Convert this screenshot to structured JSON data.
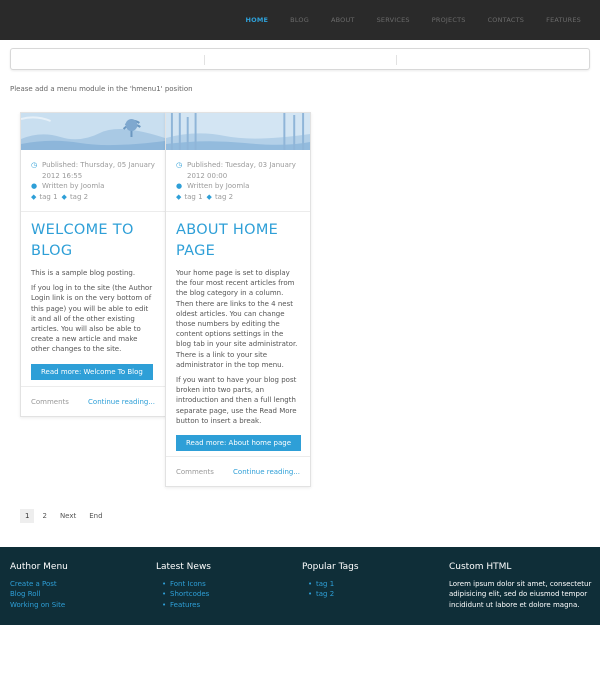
{
  "nav": {
    "items": [
      "HOME",
      "BLOG",
      "ABOUT",
      "SERVICES",
      "PROJECTS",
      "CONTACTS",
      "FEATURES"
    ]
  },
  "notice": "Please add a menu module in the 'hmenu1' position",
  "articles": [
    {
      "published": "Published: Thursday, 05 January 2012 16:55",
      "author": "Written by Joomla",
      "tag1": "tag 1",
      "tag2": "tag 2",
      "title": "WELCOME TO BLOG",
      "p1": "This is a sample blog posting.",
      "p2": "If you log in to the site (the Author Login link is on the very bottom of this page) you will be able to edit it and all of the other existing articles. You will also be able to create a new article and make other changes to the site.",
      "readmore": "Read more: Welcome To Blog",
      "comments": "Comments",
      "continue": "Continue reading..."
    },
    {
      "published": "Published: Tuesday, 03 January 2012 00:00",
      "author": "Written by Joomla",
      "tag1": "tag 1",
      "tag2": "tag 2",
      "title": "ABOUT HOME PAGE",
      "p1": "Your home page is set to display the four most recent articles from the blog category in a column. Then there are links to the 4 nest oldest articles. You can change those numbers by editing the content options settings in the blog tab in your site administrator. There is a link to your site administrator in the top menu.",
      "p2": "If you want to have your blog post broken into two parts, an introduction and then a full length separate page, use the Read More button to insert a break.",
      "readmore": "Read more: About home page",
      "comments": "Comments",
      "continue": "Continue reading..."
    }
  ],
  "pagination": {
    "p1": "1",
    "p2": "2",
    "next": "Next",
    "end": "End"
  },
  "footer": {
    "author_menu": {
      "title": "Author Menu",
      "links": [
        "Create a Post",
        "Blog Roll",
        "Working on Site"
      ]
    },
    "latest_news": {
      "title": "Latest News",
      "items": [
        "Font Icons",
        "Shortcodes",
        "Features"
      ]
    },
    "popular_tags": {
      "title": "Popular Tags",
      "items": [
        "tag 1",
        "tag 2"
      ]
    },
    "custom_html": {
      "title": "Custom HTML",
      "text": "Lorem ipsum dolor sit amet, consectetur adipisicing elit, sed do eiusmod tempor incididunt ut labore et dolore magna."
    }
  },
  "colors": {
    "accent": "#2e9fd7",
    "topbar": "#2a2a2a",
    "footer": "#0f2e38"
  }
}
